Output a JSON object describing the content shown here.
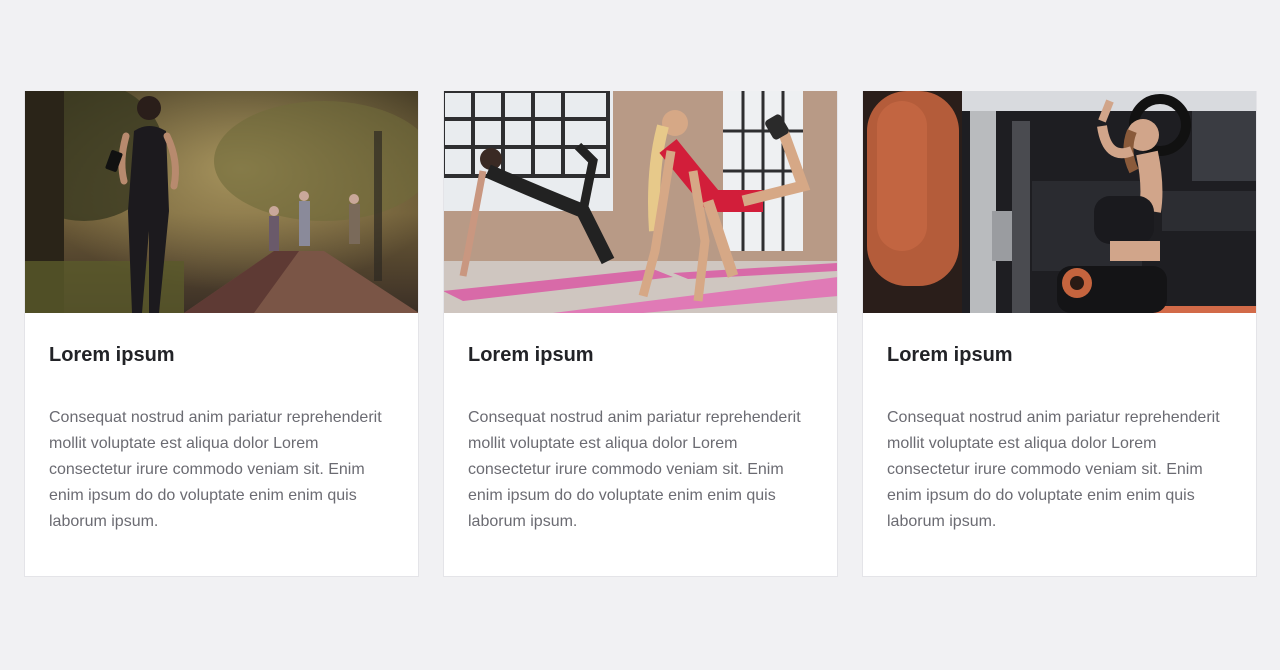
{
  "cards": [
    {
      "image": "woman-jogging-in-park-photo",
      "title": "Lorem ipsum",
      "text": "Consequat nostrud anim pariatur reprehenderit mollit voluptate est aliqua dolor Lorem consectetur irure commodo veniam sit. Enim enim ipsum do do voluptate enim enim quis laborum ipsum."
    },
    {
      "image": "women-exercising-on-yoga-mats-photo",
      "title": "Lorem ipsum",
      "text": "Consequat nostrud anim pariatur reprehenderit mollit voluptate est aliqua dolor Lorem consectetur irure commodo veniam sit. Enim enim ipsum do do voluptate enim enim quis laborum ipsum."
    },
    {
      "image": "woman-using-gym-machine-photo",
      "title": "Lorem ipsum",
      "text": "Consequat nostrud anim pariatur reprehenderit mollit voluptate est aliqua dolor Lorem consectetur irure commodo veniam sit. Enim enim ipsum do do voluptate enim enim quis laborum ipsum."
    }
  ]
}
